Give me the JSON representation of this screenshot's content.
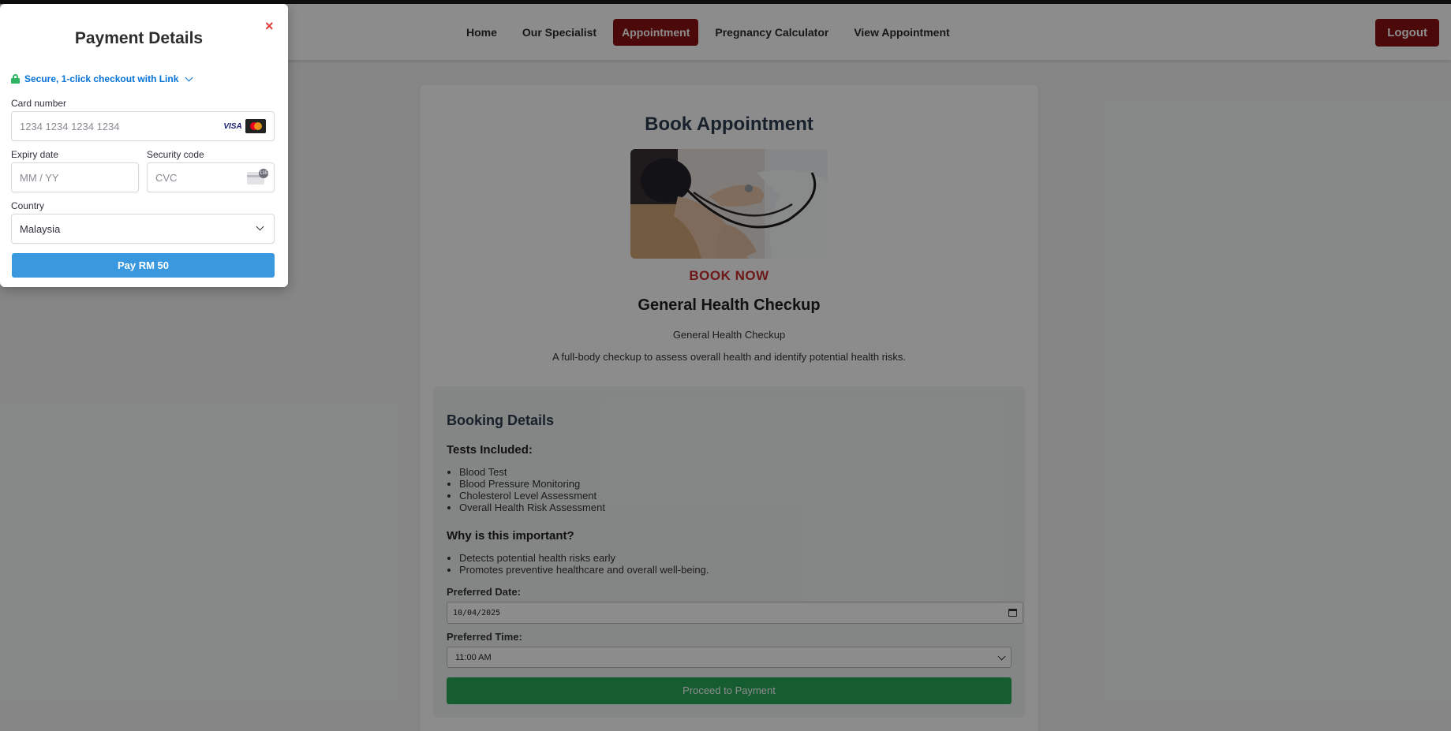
{
  "nav": {
    "items": [
      {
        "label": "Home",
        "active": false
      },
      {
        "label": "Our Specialist",
        "active": false
      },
      {
        "label": "Appointment",
        "active": true
      },
      {
        "label": "Pregnancy Calculator",
        "active": false
      },
      {
        "label": "View Appointment",
        "active": false
      }
    ],
    "logout_label": "Logout"
  },
  "main": {
    "title": "Book Appointment",
    "book_now_label": "BOOK NOW",
    "service_title": "General Health Checkup",
    "service_subtitle": "General Health Checkup",
    "service_description": "A full-body checkup to assess overall health and identify potential health risks."
  },
  "booking": {
    "heading": "Booking Details",
    "tests_heading": "Tests Included:",
    "tests": [
      "Blood Test",
      "Blood Pressure Monitoring",
      "Cholesterol Level Assessment",
      "Overall Health Risk Assessment"
    ],
    "importance_heading": "Why is this important?",
    "importance": [
      "Detects potential health risks early",
      "Promotes preventive healthcare and overall well-being."
    ],
    "date_label": "Preferred Date:",
    "date_value": "10/04/2025",
    "time_label": "Preferred Time:",
    "time_value": "11:00 AM",
    "proceed_label": "Proceed to Payment"
  },
  "payment_modal": {
    "title": "Payment Details",
    "close_symbol": "×",
    "link_text": "Secure, 1-click checkout with Link",
    "card_number_label": "Card number",
    "card_number_placeholder": "1234 1234 1234 1234",
    "visa_text": "VISA",
    "expiry_label": "Expiry date",
    "expiry_placeholder": "MM / YY",
    "security_label": "Security code",
    "security_placeholder": "CVC",
    "cvc_badge": "135",
    "country_label": "Country",
    "country_value": "Malaysia",
    "pay_label": "Pay RM 50"
  },
  "colors": {
    "accent_red": "#8b1113",
    "book_now": "#c62d2d",
    "proceed_green": "#28a85a",
    "pay_blue": "#3a98de",
    "link_blue": "#0572d6",
    "lock_green": "#2fb463"
  },
  "icons": [
    "calendar-icon",
    "chevron-down-icon",
    "lock-icon",
    "visa-logo",
    "mastercard-logo",
    "cvc-card-icon",
    "close-icon"
  ]
}
